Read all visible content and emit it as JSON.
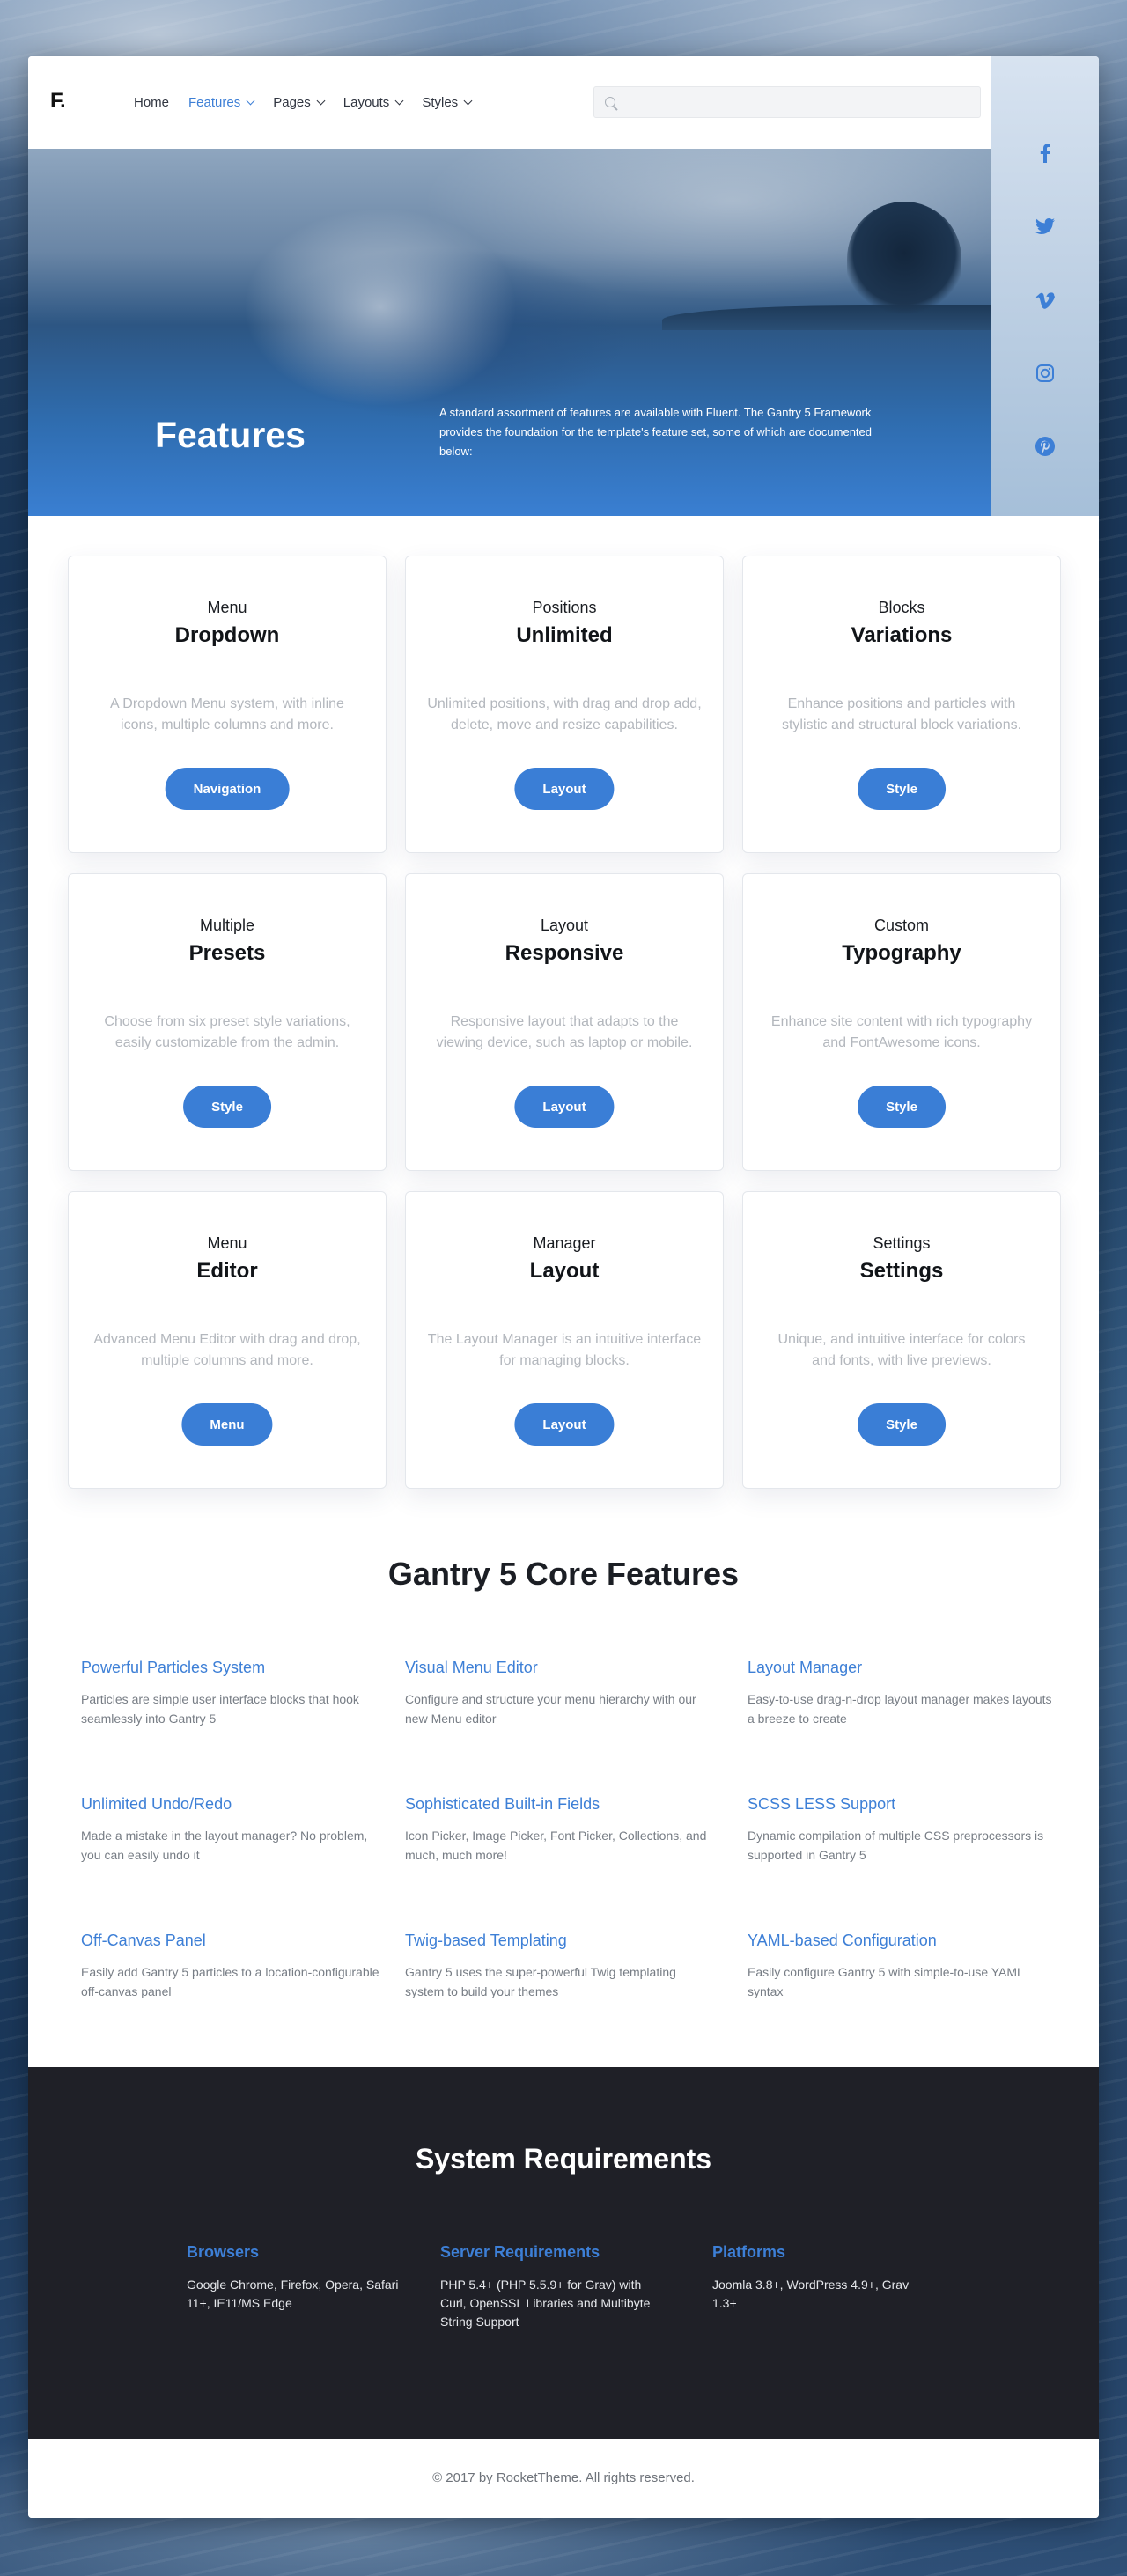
{
  "header": {
    "logo": "F.",
    "nav": [
      {
        "label": "Home",
        "has_dropdown": false,
        "active": false
      },
      {
        "label": "Features",
        "has_dropdown": true,
        "active": true
      },
      {
        "label": "Pages",
        "has_dropdown": true,
        "active": false
      },
      {
        "label": "Layouts",
        "has_dropdown": true,
        "active": false
      },
      {
        "label": "Styles",
        "has_dropdown": true,
        "active": false
      }
    ],
    "search": {
      "placeholder": "",
      "value": ""
    }
  },
  "social": [
    "facebook-icon",
    "twitter-icon",
    "vimeo-icon",
    "instagram-icon",
    "pinterest-icon"
  ],
  "hero": {
    "title": "Features",
    "text": "A standard assortment of features are available with Fluent. The Gantry 5 Framework provides the foundation for the template's feature set, some of which are documented below:"
  },
  "cards": [
    {
      "sub": "Menu",
      "title": "Dropdown",
      "desc": "A Dropdown Menu system, with inline icons, multiple columns and more.",
      "button": "Navigation"
    },
    {
      "sub": "Positions",
      "title": "Unlimited",
      "desc": "Unlimited positions, with drag and drop add, delete, move and resize capabilities.",
      "button": "Layout"
    },
    {
      "sub": "Blocks",
      "title": "Variations",
      "desc": "Enhance positions and particles with stylistic and structural block variations.",
      "button": "Style"
    },
    {
      "sub": "Multiple",
      "title": "Presets",
      "desc": "Choose from six preset style variations, easily customizable from the admin.",
      "button": "Style"
    },
    {
      "sub": "Layout",
      "title": "Responsive",
      "desc": "Responsive layout that adapts to the viewing device, such as laptop or mobile.",
      "button": "Layout"
    },
    {
      "sub": "Custom",
      "title": "Typography",
      "desc": "Enhance site content with rich typography and FontAwesome icons.",
      "button": "Style"
    },
    {
      "sub": "Menu",
      "title": "Editor",
      "desc": "Advanced Menu Editor with drag and drop, multiple columns and more.",
      "button": "Menu"
    },
    {
      "sub": "Manager",
      "title": "Layout",
      "desc": "The Layout Manager is an intuitive interface for managing blocks.",
      "button": "Layout"
    },
    {
      "sub": "Settings",
      "title": "Settings",
      "desc": "Unique, and intuitive interface for colors and fonts, with live previews.",
      "button": "Style"
    }
  ],
  "core": {
    "title": "Gantry 5 Core Features",
    "features": [
      {
        "title": "Powerful Particles System",
        "desc": "Particles are simple user interface blocks that hook seamlessly into Gantry 5"
      },
      {
        "title": "Visual Menu Editor",
        "desc": "Configure and structure your menu hierarchy with our new Menu editor"
      },
      {
        "title": "Layout Manager",
        "desc": "Easy-to-use drag-n-drop layout manager makes layouts a breeze to create"
      },
      {
        "title": "Unlimited Undo/Redo",
        "desc": "Made a mistake in the layout manager? No problem, you can easily undo it"
      },
      {
        "title": "Sophisticated Built-in Fields",
        "desc": "Icon Picker, Image Picker, Font Picker, Collections, and much, much more!"
      },
      {
        "title": "SCSS LESS Support",
        "desc": "Dynamic compilation of multiple CSS preprocessors is supported in Gantry 5"
      },
      {
        "title": "Off-Canvas Panel",
        "desc": "Easily add Gantry 5 particles to a location-configurable off-canvas panel"
      },
      {
        "title": "Twig-based Templating",
        "desc": "Gantry 5 uses the super-powerful Twig templating system to build your themes"
      },
      {
        "title": "YAML-based Configuration",
        "desc": "Easily configure Gantry 5 with simple-to-use YAML syntax"
      }
    ]
  },
  "sysreq": {
    "title": "System Requirements",
    "columns": [
      {
        "title": "Browsers",
        "text": "Google Chrome, Firefox, Opera, Safari 11+, IE11/MS Edge"
      },
      {
        "title": "Server Requirements",
        "text": "PHP 5.4+ (PHP 5.5.9+ for Grav) with Curl, OpenSSL Libraries and Multibyte String Support"
      },
      {
        "title": "Platforms",
        "text": "Joomla 3.8+, WordPress 4.9+, Grav 1.3+"
      }
    ]
  },
  "footer": {
    "text": "© 2017 by RocketTheme. All rights reserved."
  },
  "colors": {
    "accent": "#3a7ed6",
    "dark": "#1f2027"
  }
}
